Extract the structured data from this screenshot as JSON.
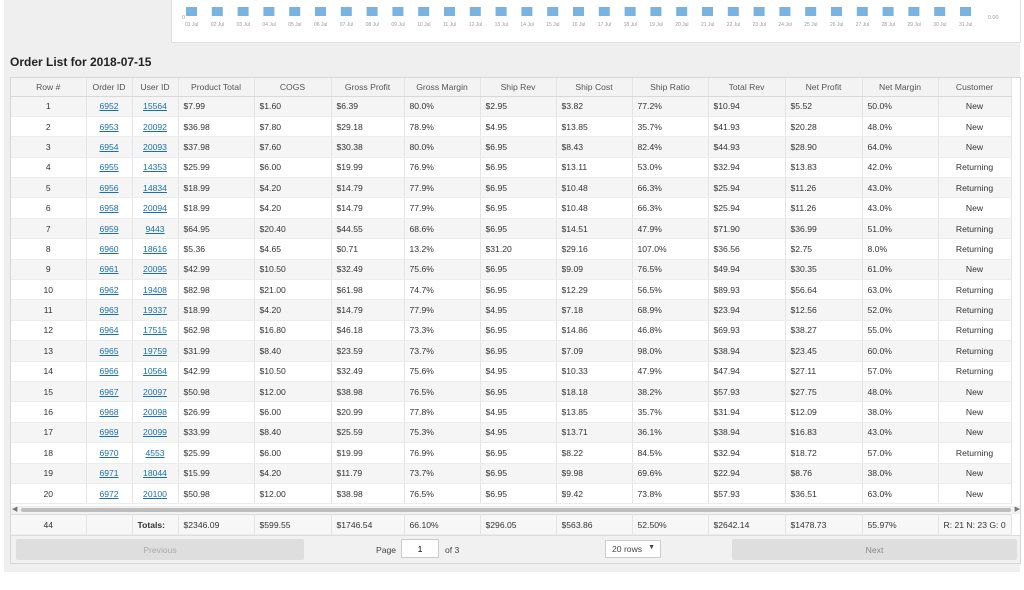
{
  "chart": {
    "x_labels": [
      "01 Jul",
      "02 Jul",
      "03 Jul",
      "04 Jul",
      "05 Jul",
      "06 Jul",
      "07 Jul",
      "08 Jul",
      "09 Jul",
      "10 Jul",
      "11 Jul",
      "12 Jul",
      "13 Jul",
      "14 Jul",
      "15 Jul",
      "16 Jul",
      "17 Jul",
      "18 Jul",
      "19 Jul",
      "20 Jul",
      "21 Jul",
      "22 Jul",
      "23 Jul",
      "24 Jul",
      "25 Jul",
      "26 Jul",
      "27 Jul",
      "28 Jul",
      "29 Jul",
      "30 Jul",
      "31 Jul"
    ],
    "left_tick": "0",
    "right_tick": "0.00",
    "bar_color": "#7bb3e0"
  },
  "section_title": "Order List for 2018-07-15",
  "columns": [
    "Row #",
    "Order ID",
    "User ID",
    "Product Total",
    "COGS",
    "Gross Profit",
    "Gross Margin",
    "Ship Rev",
    "Ship Cost",
    "Ship Ratio",
    "Total Rev",
    "Net Profit",
    "Net Margin",
    "Customer"
  ],
  "rows": [
    [
      "1",
      "6952",
      "15564",
      "$7.99",
      "$1.60",
      "$6.39",
      "80.0%",
      "$2.95",
      "$3.82",
      "77.2%",
      "$10.94",
      "$5.52",
      "50.0%",
      "New"
    ],
    [
      "2",
      "6953",
      "20092",
      "$36.98",
      "$7.80",
      "$29.18",
      "78.9%",
      "$4.95",
      "$13.85",
      "35.7%",
      "$41.93",
      "$20.28",
      "48.0%",
      "New"
    ],
    [
      "3",
      "6954",
      "20093",
      "$37.98",
      "$7.60",
      "$30.38",
      "80.0%",
      "$6.95",
      "$8.43",
      "82.4%",
      "$44.93",
      "$28.90",
      "64.0%",
      "New"
    ],
    [
      "4",
      "6955",
      "14353",
      "$25.99",
      "$6.00",
      "$19.99",
      "76.9%",
      "$6.95",
      "$13.11",
      "53.0%",
      "$32.94",
      "$13.83",
      "42.0%",
      "Returning"
    ],
    [
      "5",
      "6956",
      "14834",
      "$18.99",
      "$4.20",
      "$14.79",
      "77.9%",
      "$6.95",
      "$10.48",
      "66.3%",
      "$25.94",
      "$11.26",
      "43.0%",
      "Returning"
    ],
    [
      "6",
      "6958",
      "20094",
      "$18.99",
      "$4.20",
      "$14.79",
      "77.9%",
      "$6.95",
      "$10.48",
      "66.3%",
      "$25.94",
      "$11.26",
      "43.0%",
      "New"
    ],
    [
      "7",
      "6959",
      "9443",
      "$64.95",
      "$20.40",
      "$44.55",
      "68.6%",
      "$6.95",
      "$14.51",
      "47.9%",
      "$71.90",
      "$36.99",
      "51.0%",
      "Returning"
    ],
    [
      "8",
      "6960",
      "18616",
      "$5.36",
      "$4.65",
      "$0.71",
      "13.2%",
      "$31.20",
      "$29.16",
      "107.0%",
      "$36.56",
      "$2.75",
      "8.0%",
      "Returning"
    ],
    [
      "9",
      "6961",
      "20095",
      "$42.99",
      "$10.50",
      "$32.49",
      "75.6%",
      "$6.95",
      "$9.09",
      "76.5%",
      "$49.94",
      "$30.35",
      "61.0%",
      "New"
    ],
    [
      "10",
      "6962",
      "19408",
      "$82.98",
      "$21.00",
      "$61.98",
      "74.7%",
      "$6.95",
      "$12.29",
      "56.5%",
      "$89.93",
      "$56.64",
      "63.0%",
      "Returning"
    ],
    [
      "11",
      "6963",
      "19337",
      "$18.99",
      "$4.20",
      "$14.79",
      "77.9%",
      "$4.95",
      "$7.18",
      "68.9%",
      "$23.94",
      "$12.56",
      "52.0%",
      "Returning"
    ],
    [
      "12",
      "6964",
      "17515",
      "$62.98",
      "$16.80",
      "$46.18",
      "73.3%",
      "$6.95",
      "$14.86",
      "46.8%",
      "$69.93",
      "$38.27",
      "55.0%",
      "Returning"
    ],
    [
      "13",
      "6965",
      "19759",
      "$31.99",
      "$8.40",
      "$23.59",
      "73.7%",
      "$6.95",
      "$7.09",
      "98.0%",
      "$38.94",
      "$23.45",
      "60.0%",
      "Returning"
    ],
    [
      "14",
      "6966",
      "10564",
      "$42.99",
      "$10.50",
      "$32.49",
      "75.6%",
      "$4.95",
      "$10.33",
      "47.9%",
      "$47.94",
      "$27.11",
      "57.0%",
      "Returning"
    ],
    [
      "15",
      "6967",
      "20097",
      "$50.98",
      "$12.00",
      "$38.98",
      "76.5%",
      "$6.95",
      "$18.18",
      "38.2%",
      "$57.93",
      "$27.75",
      "48.0%",
      "New"
    ],
    [
      "16",
      "6968",
      "20098",
      "$26.99",
      "$6.00",
      "$20.99",
      "77.8%",
      "$4.95",
      "$13.85",
      "35.7%",
      "$31.94",
      "$12.09",
      "38.0%",
      "New"
    ],
    [
      "17",
      "6969",
      "20099",
      "$33.99",
      "$8.40",
      "$25.59",
      "75.3%",
      "$4.95",
      "$13.71",
      "36.1%",
      "$38.94",
      "$16.83",
      "43.0%",
      "New"
    ],
    [
      "18",
      "6970",
      "4553",
      "$25.99",
      "$6.00",
      "$19.99",
      "76.9%",
      "$6.95",
      "$8.22",
      "84.5%",
      "$32.94",
      "$18.72",
      "57.0%",
      "Returning"
    ],
    [
      "19",
      "6971",
      "18044",
      "$15.99",
      "$4.20",
      "$11.79",
      "73.7%",
      "$6.95",
      "$9.98",
      "69.6%",
      "$22.94",
      "$8.76",
      "38.0%",
      "New"
    ],
    [
      "20",
      "6972",
      "20100",
      "$50.98",
      "$12.00",
      "$38.98",
      "76.5%",
      "$6.95",
      "$9.42",
      "73.8%",
      "$57.93",
      "$36.51",
      "63.0%",
      "New"
    ]
  ],
  "totals": [
    "44",
    "",
    "Totals:",
    "$2346.09",
    "$599.55",
    "$1746.54",
    "66.10%",
    "$296.05",
    "$563.86",
    "52.50%",
    "$2642.14",
    "$1478.73",
    "55.97%",
    "R: 21 N: 23 G: 0"
  ],
  "pager": {
    "prev_label": "Previous",
    "next_label": "Next",
    "page_label": "Page",
    "page_value": "1",
    "of_label": "of 3",
    "rows_label": "20 rows"
  },
  "icons": {
    "caret": "caret-down-icon",
    "scroll_left": "arrow-left-icon",
    "scroll_right": "arrow-right-icon"
  }
}
